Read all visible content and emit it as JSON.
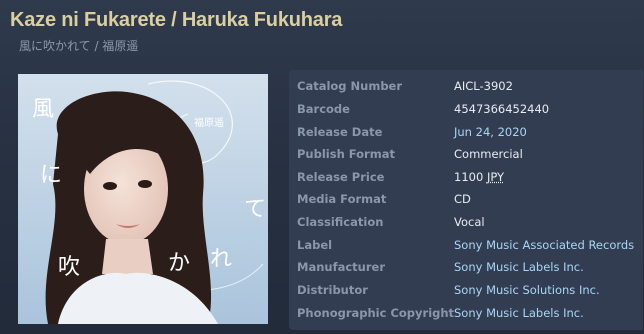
{
  "header": {
    "title": "Kaze ni Fukarete / Haruka Fukuhara",
    "subtitle": "風に吹かれて / 福原遥"
  },
  "cover": {
    "alt_text_vertical_1": "風",
    "alt_text_vertical_2": "に",
    "alt_text_vertical_3": "吹",
    "alt_text_vertical_4": "か",
    "alt_text_vertical_5": "れ",
    "alt_text_vertical_6": "て",
    "artist_mark": "福原遥"
  },
  "details": [
    {
      "label": "Catalog Number",
      "value": "AICL-3902",
      "link": false
    },
    {
      "label": "Barcode",
      "value": "4547366452440",
      "link": false
    },
    {
      "label": "Release Date",
      "value": "Jun 24, 2020",
      "link": true
    },
    {
      "label": "Publish Format",
      "value": "Commercial",
      "link": false
    },
    {
      "label": "Release Price",
      "value": "1100",
      "unit": "JPY",
      "link": false
    },
    {
      "label": "Media Format",
      "value": "CD",
      "link": false
    },
    {
      "label": "Classification",
      "value": "Vocal",
      "link": false
    },
    {
      "label": "Label",
      "value": "Sony Music Associated Records",
      "link": true
    },
    {
      "label": "Manufacturer",
      "value": "Sony Music Labels Inc.",
      "link": true
    },
    {
      "label": "Distributor",
      "value": "Sony Music Solutions Inc.",
      "link": true
    },
    {
      "label": "Phonographic Copyright",
      "value": "Sony Music Labels Inc.",
      "link": true
    }
  ],
  "colors": {
    "title": "#d9cfa1",
    "label": "#8a97ab",
    "value": "#e8ecf2",
    "link": "#a9d6f5",
    "panel": "#323d51"
  }
}
